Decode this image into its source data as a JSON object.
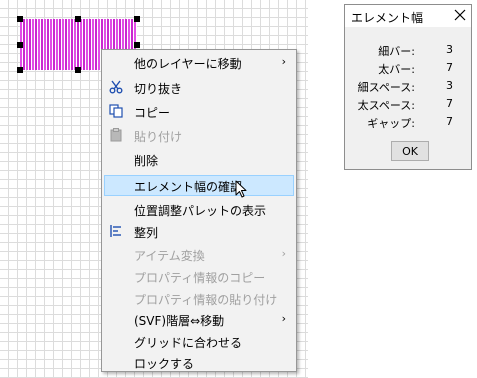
{
  "canvas": {
    "selection": "barcode"
  },
  "context_menu": {
    "items": [
      {
        "label": "他のレイヤーに移動",
        "submenu": true,
        "enabled": true
      },
      {
        "label": "切り抜き",
        "icon": "scissors-icon",
        "enabled": true
      },
      {
        "label": "コピー",
        "icon": "copy-icon",
        "enabled": true
      },
      {
        "label": "貼り付け",
        "icon": "paste-icon",
        "enabled": false
      },
      {
        "label": "削除",
        "enabled": true
      },
      {
        "label": "エレメント幅の確認",
        "enabled": true,
        "highlighted": true
      },
      {
        "label": "位置調整パレットの表示",
        "enabled": true
      },
      {
        "label": "整列",
        "icon": "align-icon",
        "enabled": true
      },
      {
        "label": "アイテム変換",
        "submenu": true,
        "enabled": false
      },
      {
        "label": "プロパティ情報のコピー",
        "enabled": false
      },
      {
        "label": "プロパティ情報の貼り付け",
        "enabled": false
      },
      {
        "label": "(SVF)階層⇔移動",
        "submenu": true,
        "enabled": true
      },
      {
        "label": "グリッドに合わせる",
        "enabled": true
      },
      {
        "label": "ロックする",
        "enabled": true
      }
    ],
    "submenu_arrow": "›"
  },
  "dialog": {
    "title": "エレメント幅",
    "rows": [
      {
        "label": "細バー:",
        "value": "3"
      },
      {
        "label": "太バー:",
        "value": "7"
      },
      {
        "label": "細スペース:",
        "value": "3"
      },
      {
        "label": "太スペース:",
        "value": "7"
      },
      {
        "label": "ギャップ:",
        "value": "7"
      }
    ],
    "ok_label": "OK"
  },
  "colors": {
    "barcode_bar": "#e14ee6",
    "menu_highlight": "#cce8ff",
    "menu_highlight_border": "#99d1ff",
    "disabled_text": "#a0a0a0"
  }
}
